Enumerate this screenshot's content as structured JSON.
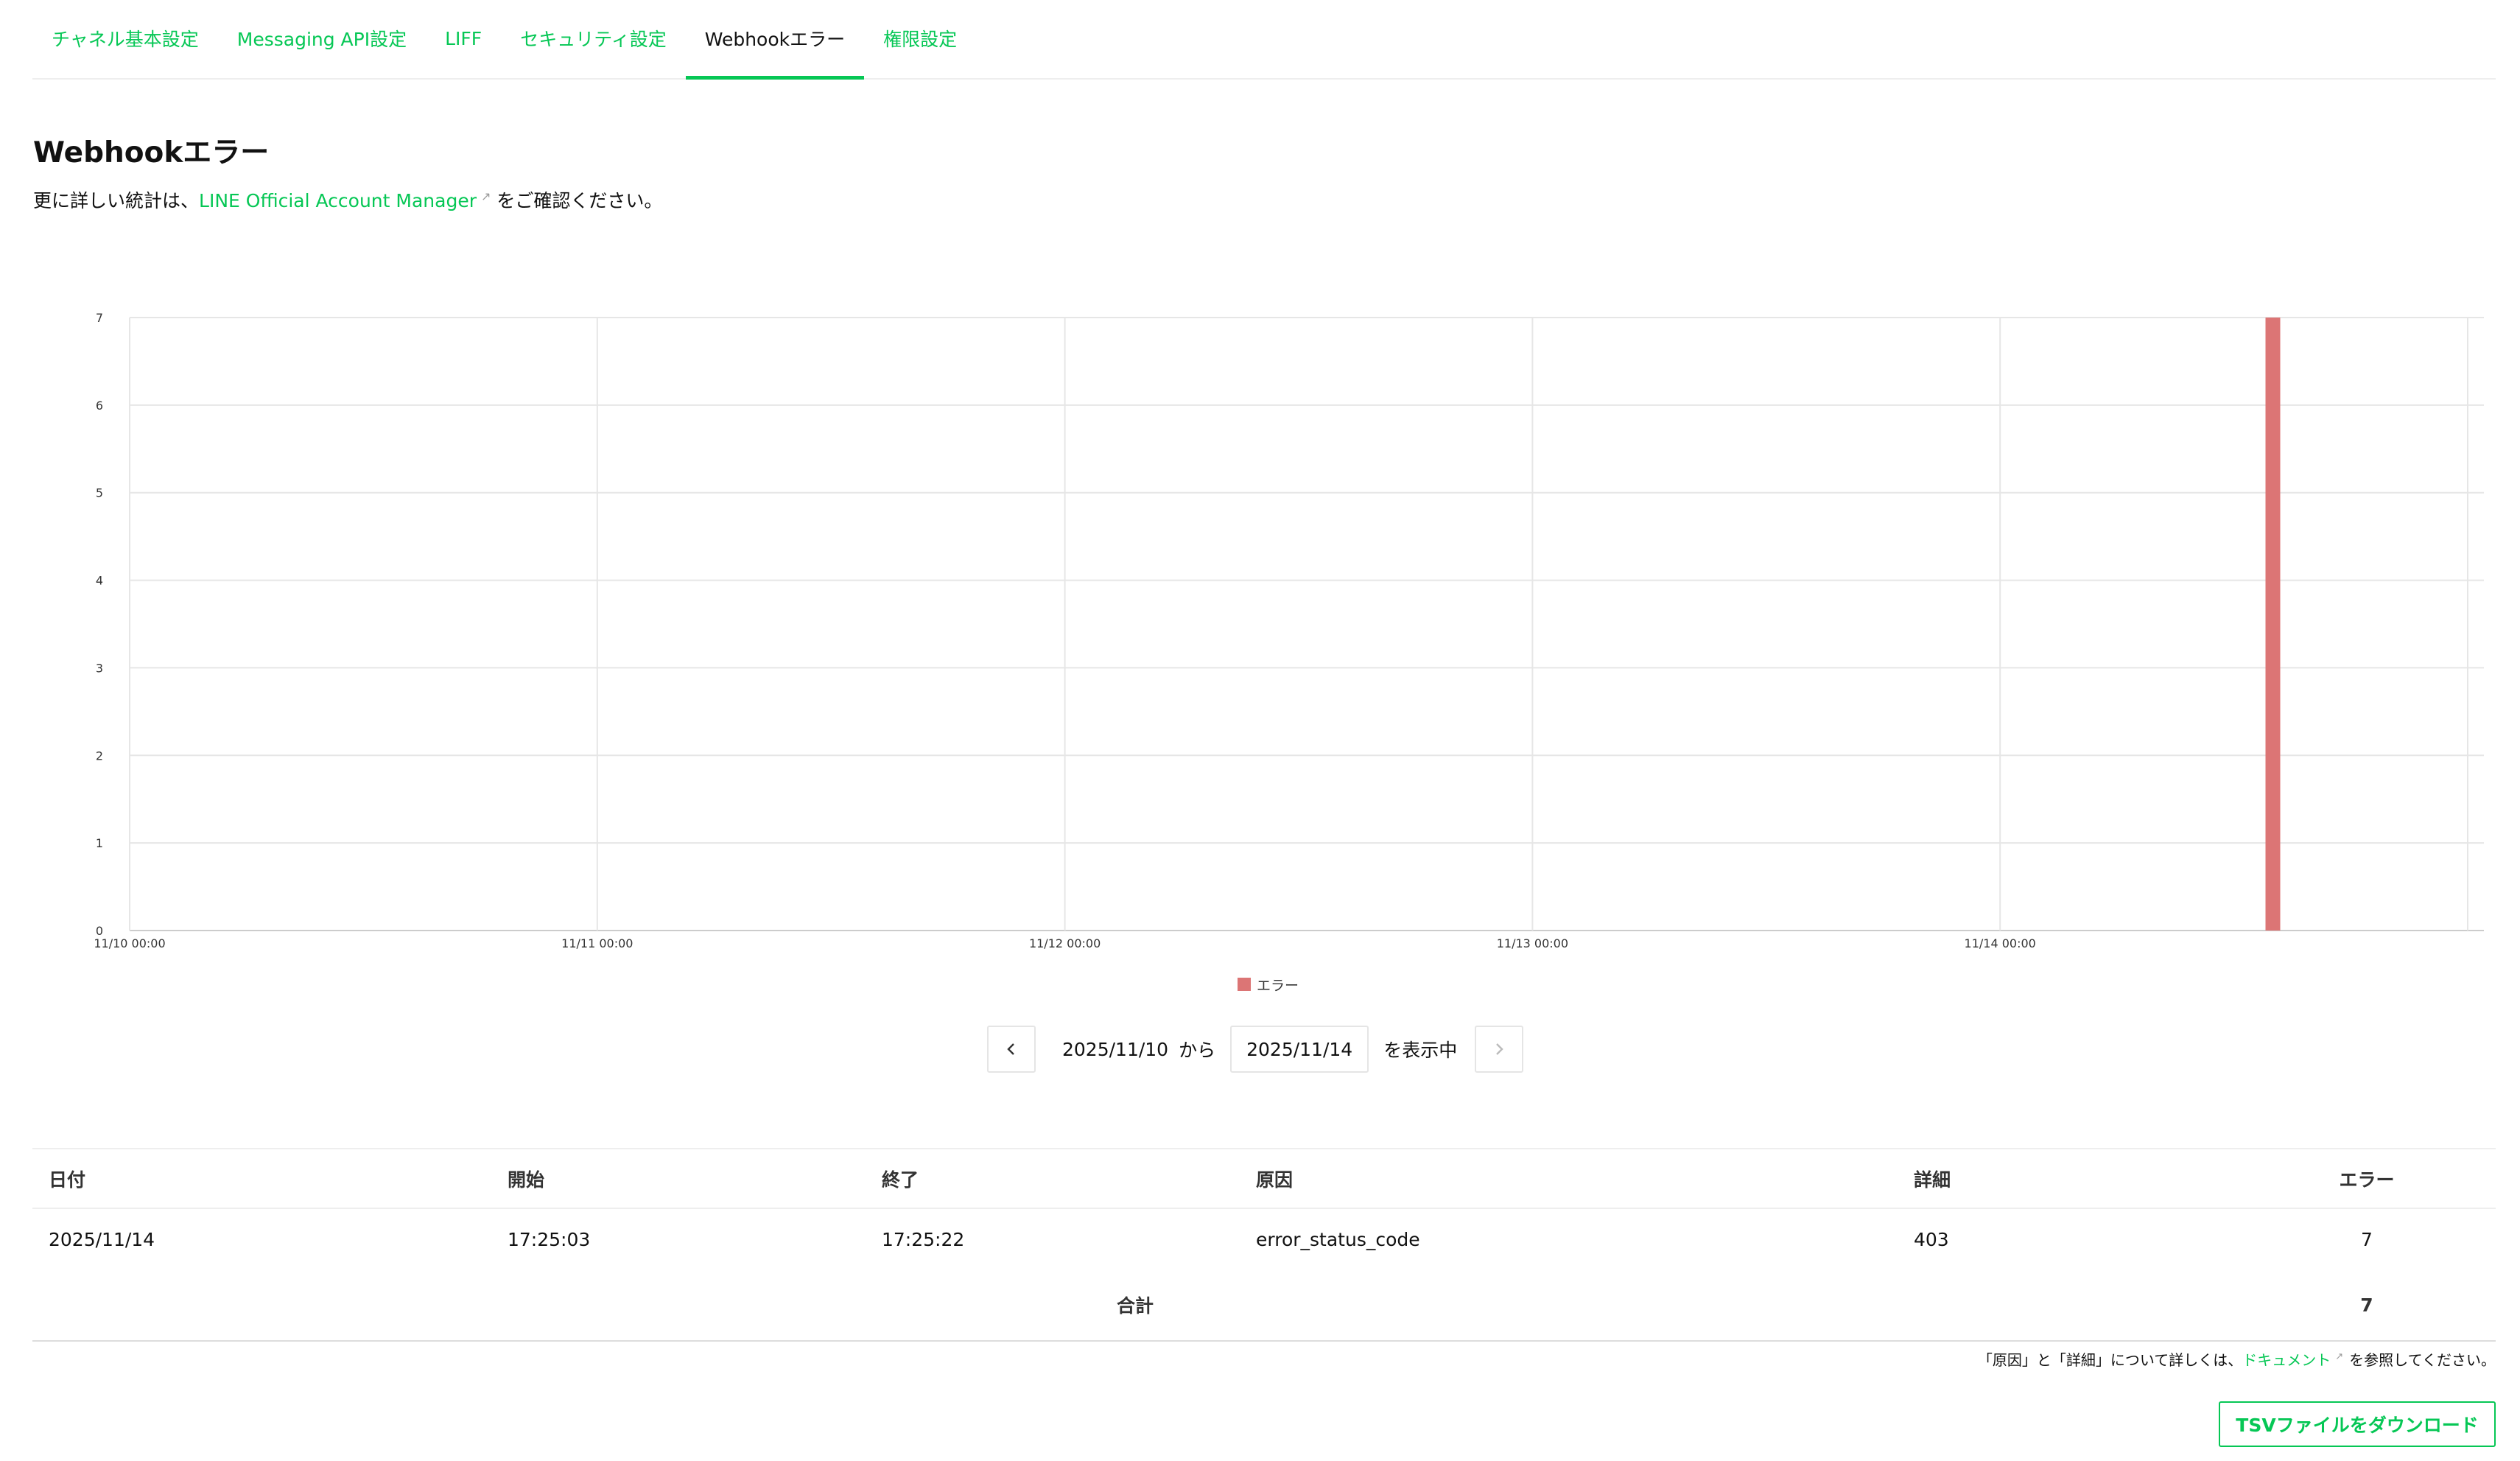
{
  "tabs": [
    {
      "label": "チャネル基本設定",
      "active": false
    },
    {
      "label": "Messaging API設定",
      "active": false
    },
    {
      "label": "LIFF",
      "active": false
    },
    {
      "label": "セキュリティ設定",
      "active": false
    },
    {
      "label": "Webhookエラー",
      "active": true
    },
    {
      "label": "権限設定",
      "active": false
    }
  ],
  "page": {
    "title": "Webhookエラー",
    "desc_prefix": "更に詳しい統計は、",
    "desc_link": "LINE Official Account Manager",
    "desc_suffix": "をご確認ください。",
    "external_icon": "external-link-icon"
  },
  "colors": {
    "accent": "#06c755",
    "error_bar": "#dc7575"
  },
  "chart_data": {
    "type": "bar",
    "x": [
      "2025-11-14 14:00"
    ],
    "values": [
      7
    ],
    "xlim": [
      "2025-11-10 00:00",
      "2025-11-15 00:00"
    ],
    "x_ticks": [
      "11/10 00:00",
      "11/11 00:00",
      "11/12 00:00",
      "11/13 00:00",
      "11/14 00:00"
    ],
    "y_ticks": [
      0,
      1,
      2,
      3,
      4,
      5,
      6,
      7
    ],
    "ylim": [
      0,
      7
    ],
    "grid": true,
    "legend": [
      {
        "name": "エラー",
        "color": "#dc7575"
      }
    ],
    "legend_position": "bottom"
  },
  "range": {
    "from": "2025/11/10",
    "from_suffix": "から",
    "to": "2025/11/14",
    "to_suffix": "を表示中",
    "prev_icon": "chevron-left-icon",
    "next_icon": "chevron-right-icon"
  },
  "table": {
    "headers": {
      "date": "日付",
      "start": "開始",
      "end": "終了",
      "reason": "原因",
      "detail": "詳細",
      "errors": "エラー"
    },
    "rows": [
      {
        "date": "2025/11/14",
        "start": "17:25:03",
        "end": "17:25:22",
        "reason": "error_status_code",
        "detail": "403",
        "errors": "7"
      }
    ],
    "total_label": "合計",
    "total_value": "7"
  },
  "note": {
    "prefix": "「原因」と「詳細」について詳しくは、",
    "link": "ドキュメント",
    "suffix": "を参照してください。"
  },
  "download_label": "TSVファイルをダウンロード"
}
